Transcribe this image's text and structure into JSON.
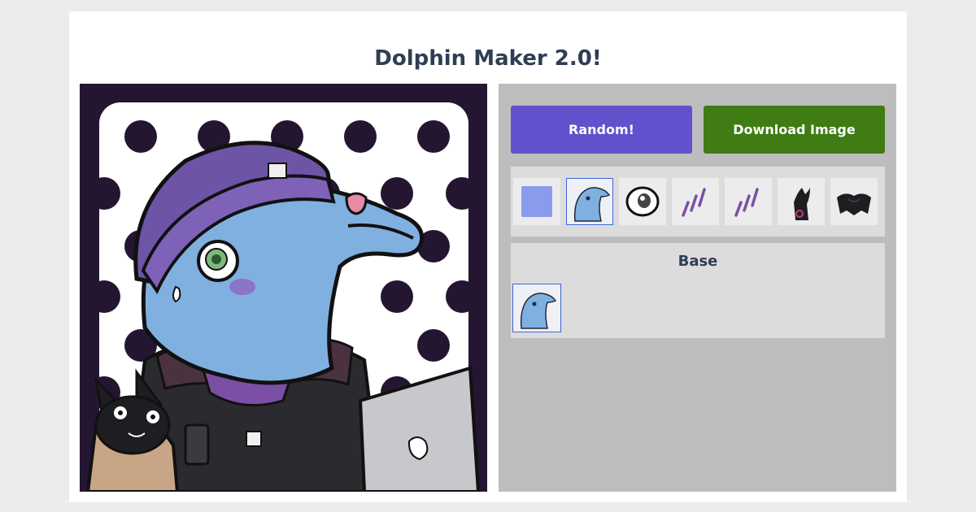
{
  "app": {
    "title": "Dolphin Maker 2.0!"
  },
  "buttons": {
    "random": "Random!",
    "download": "Download Image"
  },
  "part_categories": [
    {
      "icon": "background-color-swatch-icon",
      "color": "#8b9bec",
      "selected": false
    },
    {
      "icon": "dolphin-base-icon",
      "selected": true
    },
    {
      "icon": "eye-icon",
      "selected": false
    },
    {
      "icon": "purple-marks-icon",
      "selected": false
    },
    {
      "icon": "purple-marks-icon",
      "selected": false
    },
    {
      "icon": "black-companion-icon",
      "selected": false
    },
    {
      "icon": "black-clothing-icon",
      "selected": false
    }
  ],
  "options_panel": {
    "title": "Base",
    "options": [
      {
        "icon": "dolphin-base-option-icon",
        "selected": true
      }
    ]
  },
  "colors": {
    "random_button": "#6251cc",
    "download_button": "#3f7d14",
    "selection_border": "#3b66d6",
    "title_text": "#2f3e53"
  }
}
